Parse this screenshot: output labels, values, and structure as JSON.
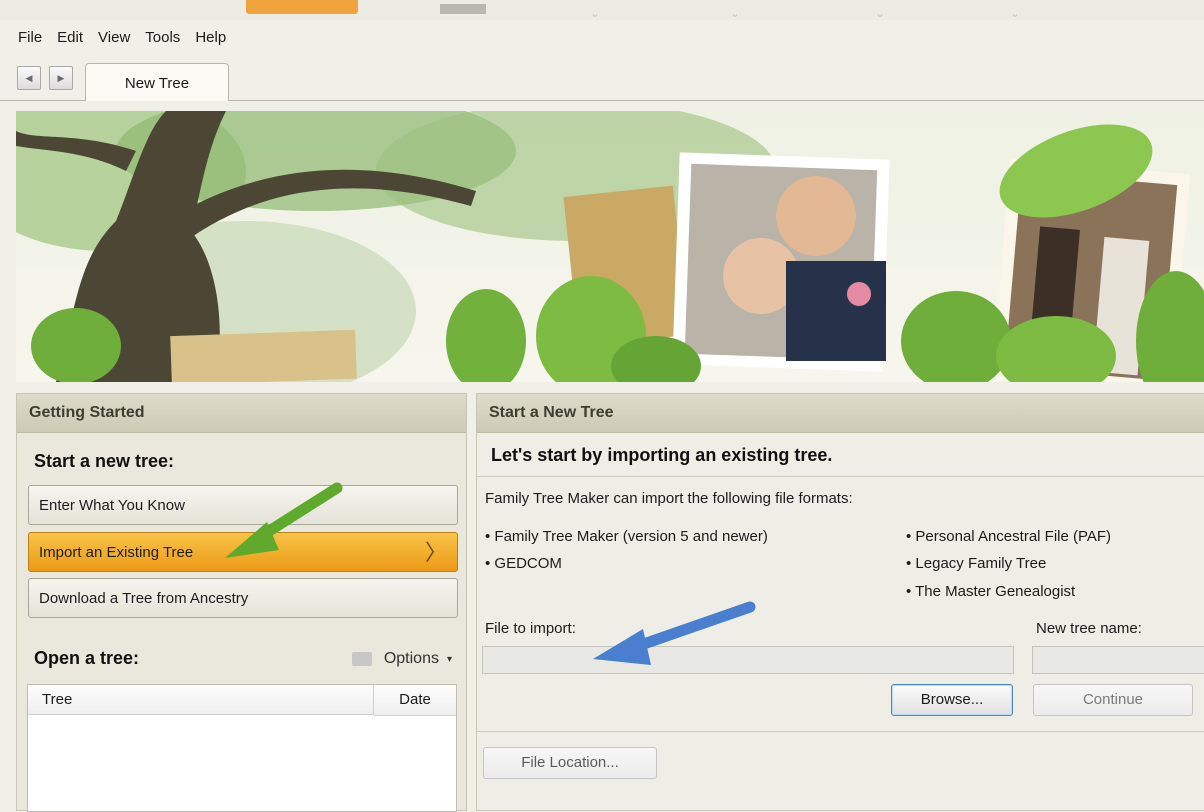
{
  "menu": [
    "File",
    "Edit",
    "View",
    "Tools",
    "Help"
  ],
  "tab": {
    "label": "New Tree"
  },
  "getting_started": {
    "header": "Getting Started",
    "start_heading": "Start a new tree:",
    "options": [
      {
        "label": "Enter What You Know",
        "active": false
      },
      {
        "label": "Import an Existing Tree",
        "active": true
      },
      {
        "label": "Download a Tree from Ancestry",
        "active": false
      }
    ],
    "open_heading": "Open a tree:",
    "options_menu": "Options",
    "table_columns": [
      "Tree",
      "Date"
    ]
  },
  "start_new_tree": {
    "header": "Start a New Tree",
    "lead": "Let's start by importing an existing tree.",
    "intro": "Family Tree Maker can import the following file formats:",
    "formats_left": [
      "• Family Tree Maker (version 5 and newer)",
      "• GEDCOM"
    ],
    "formats_right": [
      "• Personal Ancestral File (PAF)",
      "• Legacy Family Tree",
      "• The Master Genealogist"
    ],
    "file_to_import_label": "File to import:",
    "new_tree_name_label": "New tree name:",
    "file_to_import_value": "",
    "new_tree_name_value": "",
    "browse_label": "Browse...",
    "continue_label": "Continue",
    "file_location_label": "File Location..."
  },
  "colors": {
    "active_option": "#f0a020",
    "green_arrow": "#5faa2c",
    "blue_arrow": "#4a7fcf",
    "panel_header": "#d6d4c0"
  }
}
